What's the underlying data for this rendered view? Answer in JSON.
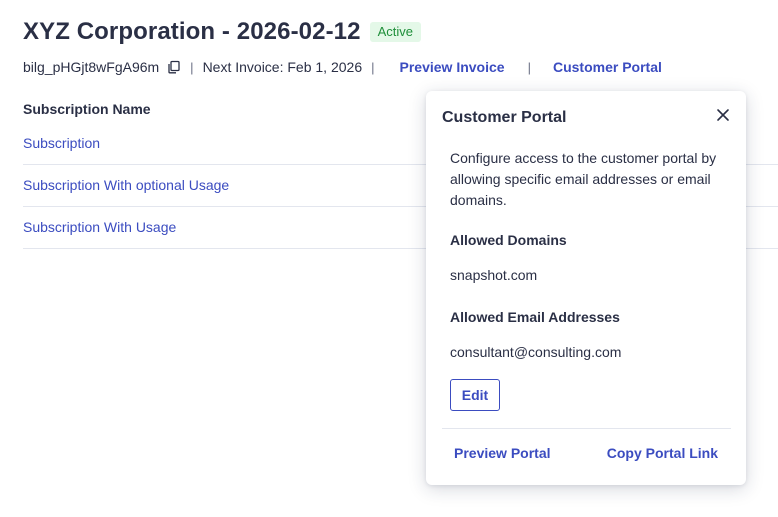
{
  "header": {
    "title": "XYZ Corporation - 2026-02-12",
    "status": "Active"
  },
  "meta": {
    "billing_id": "bilg_pHGjt8wFgA96m",
    "copy_icon": "copy-icon",
    "separator": "|",
    "next_invoice": "Next Invoice: Feb 1, 2026",
    "preview_invoice_label": "Preview Invoice",
    "customer_portal_label": "Customer Portal"
  },
  "table": {
    "column_header": "Subscription Name",
    "rows": [
      "Subscription",
      "Subscription With optional Usage",
      "Subscription With Usage"
    ]
  },
  "popover": {
    "title": "Customer Portal",
    "close_icon": "close-icon",
    "description": "Configure access to the customer portal by allowing specific email addresses or email domains.",
    "allowed_domains_label": "Allowed Domains",
    "allowed_domains_value": "snapshot.com",
    "allowed_emails_label": "Allowed Email Addresses",
    "allowed_emails_value": "consultant@consulting.com",
    "edit_label": "Edit",
    "preview_portal_label": "Preview Portal",
    "copy_portal_link_label": "Copy Portal Link"
  },
  "colors": {
    "text": "#2a2f45",
    "link": "#3b4cc0",
    "badge_bg": "#e4f8e8",
    "badge_text": "#1f8f3a",
    "divider": "#e3e6ee"
  }
}
